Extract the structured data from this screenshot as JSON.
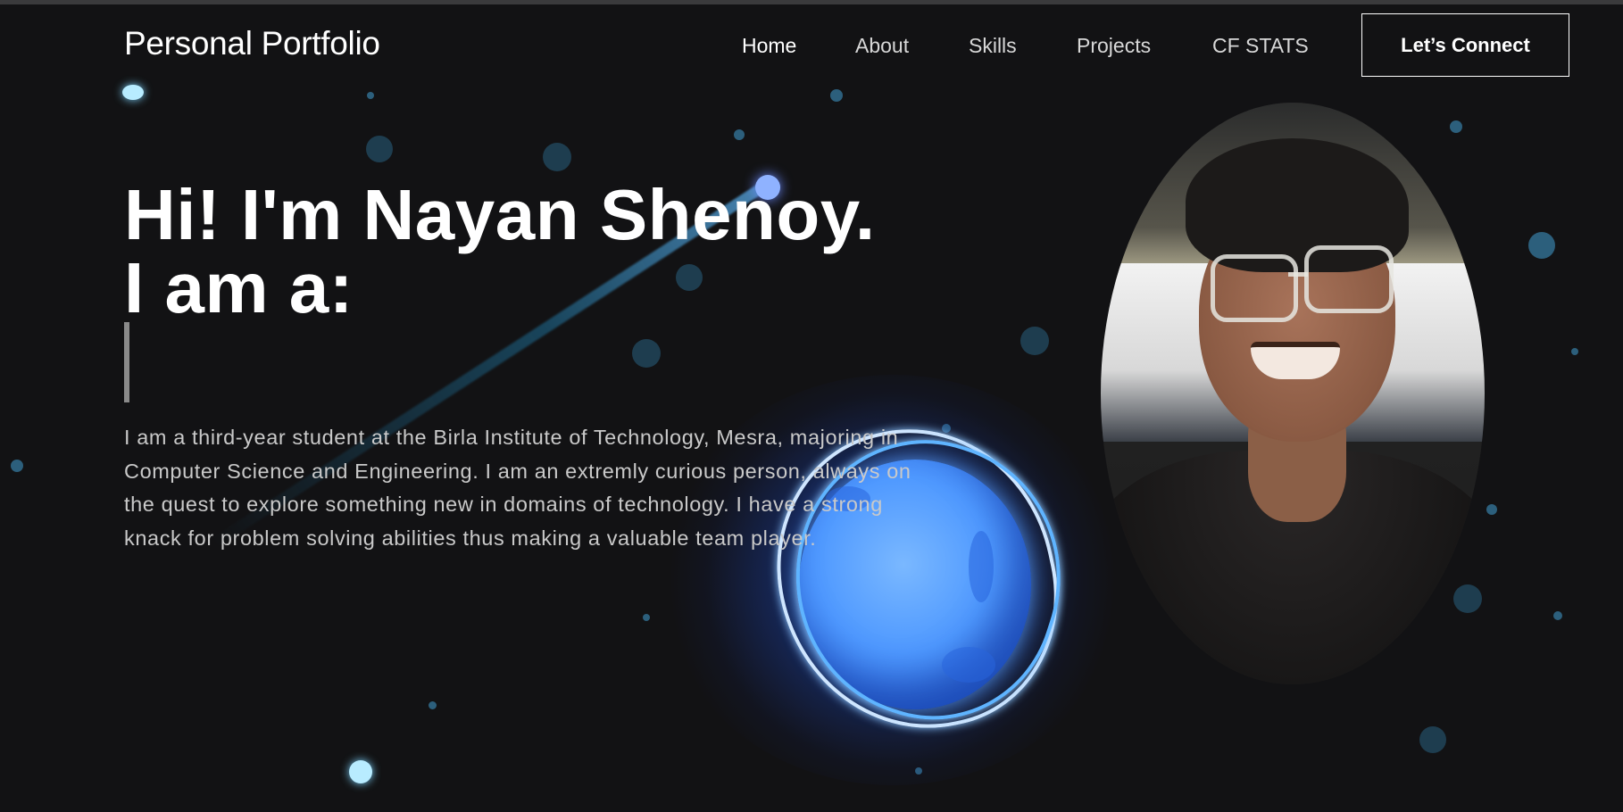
{
  "nav": {
    "logo": "Personal Portfolio",
    "links": [
      {
        "label": "Home",
        "active": true
      },
      {
        "label": "About",
        "active": false
      },
      {
        "label": "Skills",
        "active": false
      },
      {
        "label": "Projects",
        "active": false
      },
      {
        "label": "CF STATS",
        "active": false
      }
    ],
    "cta_label": "Let’s Connect"
  },
  "hero": {
    "title_line1": "Hi! I'm Nayan Shenoy.",
    "title_line2": "I am a:",
    "description": "I am a third-year student at the Birla Institute of Technology, Mesra, majoring in Computer Science and Engineering. I am an extremly curious person, always on the quest to explore something new in domains of technology. I have a strong knack for problem solving abilities thus making a valuable team player."
  },
  "icons": [
    "avatar-photo",
    "planet-illustration",
    "comet-illustration"
  ],
  "colors": {
    "background": "#121214",
    "accent_planet": "#4f99ff",
    "text_primary": "#ffffff",
    "text_secondary": "#c9c9c9"
  }
}
